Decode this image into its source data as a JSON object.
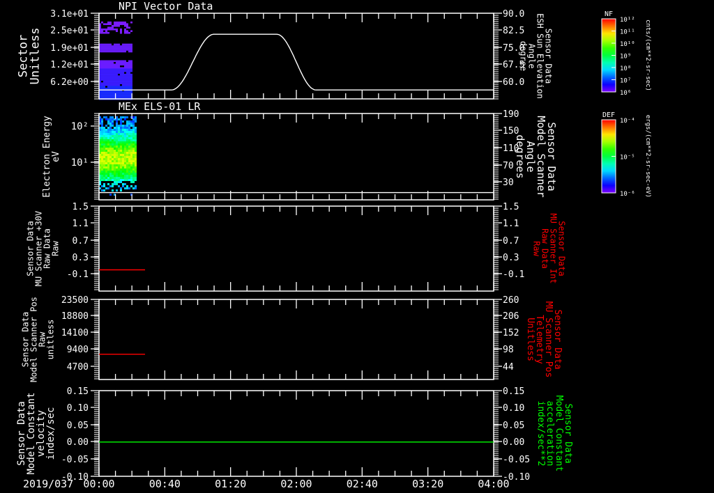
{
  "chart_data": {
    "type": "multi-panel time series",
    "date_label": "2019/037",
    "x_ticks": [
      "00:00",
      "00:40",
      "01:20",
      "02:00",
      "02:40",
      "03:20",
      "04:00"
    ],
    "x_range_minutes": [
      0,
      240
    ],
    "background": "#000000",
    "panels": [
      {
        "id": "npi",
        "type": "heatmap",
        "title": "NPI Vector Data",
        "left_label": [
          "Sector",
          "Unitless"
        ],
        "left_ticks": [
          "3.1e+01",
          "2.5e+01",
          "1.9e+01",
          "1.2e+01",
          "6.2e+00"
        ],
        "left_range": [
          0,
          31
        ],
        "data_extent_minutes": [
          0,
          20
        ],
        "sector_bands": [
          [
            24,
            28
          ],
          [
            17,
            20
          ],
          [
            11,
            14
          ],
          [
            0,
            11
          ]
        ],
        "right_label": [
          "Sensor Data",
          "ESH Sun Elevation",
          "Angle",
          "degree"
        ],
        "right_label_color": "#ffffff",
        "right_ticks": [
          "90.0",
          "82.5",
          "75.0",
          "67.5",
          "60.0"
        ],
        "right_range": [
          52.5,
          90
        ],
        "line": {
          "color": "#ffffff",
          "x": [
            0,
            44,
            57,
            70,
            108,
            120,
            132,
            240
          ],
          "y": [
            56.4,
            56.4,
            68.6,
            80.8,
            80.8,
            68.6,
            56.4,
            56.4
          ]
        },
        "colorbar": {
          "label": "NF",
          "ticks": [
            "10¹²",
            "10¹¹",
            "10¹⁰",
            "10⁹",
            "10⁸",
            "10⁷",
            "10⁶"
          ],
          "units": "cnts/(cm**2-sr-sec)"
        }
      },
      {
        "id": "els",
        "type": "heatmap",
        "title": "MEx ELS-01 LR",
        "left_label": [
          "Electron Energy",
          "eV"
        ],
        "left_ticks": [
          "10²",
          "10¹"
        ],
        "data_extent_minutes": [
          0,
          22
        ],
        "right_label": [
          "Sensor Data",
          "Model Scanner",
          "Angle",
          "degrees"
        ],
        "right_label_color": "#ffffff",
        "right_ticks": [
          "190",
          "150",
          "110",
          "70",
          "30"
        ],
        "right_range": [
          -10,
          190
        ],
        "line": {
          "color": "#ffffff",
          "x": [
            0,
            240
          ],
          "y": [
            7,
            7
          ]
        },
        "colorbar": {
          "label": "DEF",
          "ticks": [
            "10⁻⁴",
            "10⁻⁵",
            "10⁻⁶"
          ],
          "units": "ergs/(cm**2-sr-sec-eV)"
        }
      },
      {
        "id": "mu30v",
        "type": "line",
        "left_label": [
          "Sensor Data",
          "MU Scanner +30V",
          "Raw Data",
          "Raw"
        ],
        "left_ticks": [
          "1.5",
          "1.1",
          "0.7",
          "0.3",
          "-0.1"
        ],
        "left_range": [
          -0.5,
          1.5
        ],
        "right_label": [
          "Sensor Data",
          "MU Scanner Int",
          "Raw Data",
          "Raw"
        ],
        "right_label_color": "#ff0000",
        "right_ticks": [
          "1.5",
          "1.1",
          "0.7",
          "0.3",
          "-0.1"
        ],
        "line": {
          "color": "#ff0000",
          "x": [
            0,
            28
          ],
          "y": [
            0.0,
            0.0
          ]
        }
      },
      {
        "id": "mupos",
        "type": "line",
        "left_label": [
          "Sensor Data",
          "Model Scanner Pos",
          "Raw",
          "unitless"
        ],
        "left_ticks": [
          "23500",
          "18800",
          "14100",
          "9400",
          "4700"
        ],
        "left_range": [
          1000,
          23500
        ],
        "right_label": [
          "Sensor Data",
          "MU Scanner Pos",
          "Telemetry",
          "Unitless"
        ],
        "right_label_color": "#ff0000",
        "right_ticks": [
          "260",
          "206",
          "152",
          "98",
          "44"
        ],
        "line": {
          "color": "#ff0000",
          "x": [
            0,
            28
          ],
          "y": [
            8100,
            8100
          ]
        }
      },
      {
        "id": "const",
        "type": "line",
        "left_label": [
          "Sensor Data",
          "Model Constant",
          "velocity",
          "index/sec"
        ],
        "left_ticks": [
          "0.15",
          "0.10",
          "0.05",
          "0.00",
          "-0.05",
          "-0.10"
        ],
        "left_range": [
          -0.1,
          0.15
        ],
        "right_label": [
          "Sensor Data",
          "Model Constant",
          "acceleration",
          "index/sec**2"
        ],
        "right_label_color": "#00ff00",
        "right_ticks": [
          "0.15",
          "0.10",
          "0.05",
          "0.00",
          "-0.05",
          "-0.10"
        ],
        "line": {
          "color": "#00ff00",
          "x": [
            0,
            240
          ],
          "y": [
            0,
            0
          ]
        }
      }
    ]
  }
}
